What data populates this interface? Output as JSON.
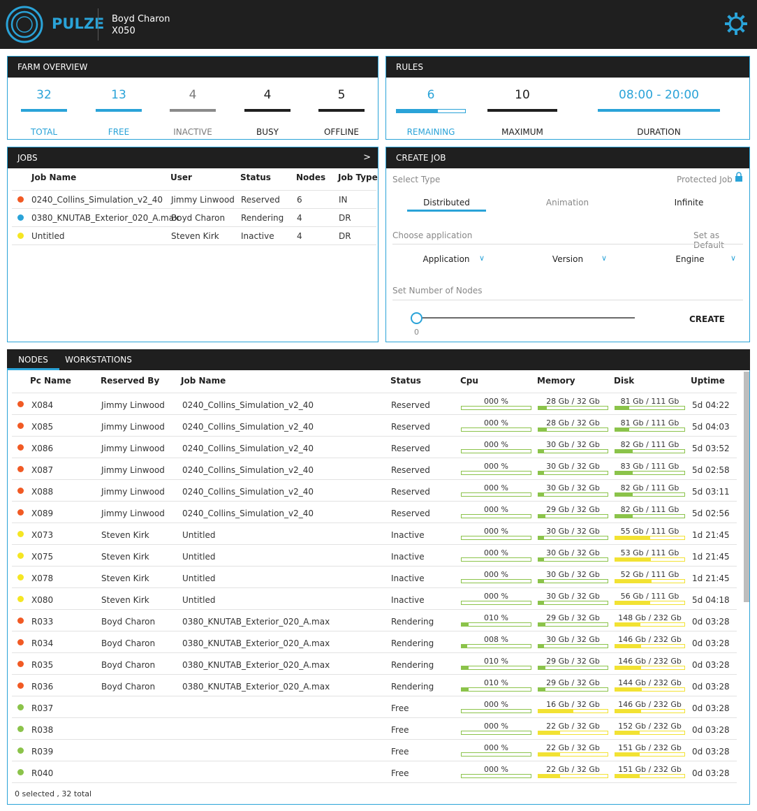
{
  "header": {
    "brand": "PULZE",
    "user_name": "Boyd Charon",
    "user_station": "X050"
  },
  "farm_overview": {
    "title": "FARM OVERVIEW",
    "stats": [
      {
        "value": "32",
        "label": "TOTAL"
      },
      {
        "value": "13",
        "label": "FREE"
      },
      {
        "value": "4",
        "label": "INACTIVE"
      },
      {
        "value": "4",
        "label": "BUSY"
      },
      {
        "value": "5",
        "label": "OFFLINE"
      }
    ]
  },
  "rules": {
    "title": "RULES",
    "remaining": {
      "value": "6",
      "label": "REMAINING",
      "fraction": 0.6
    },
    "maximum": {
      "value": "10",
      "label": "MAXIMUM"
    },
    "duration": {
      "value": "08:00 - 20:00",
      "label": "DURATION"
    }
  },
  "jobs": {
    "title": "JOBS",
    "expand": ">",
    "columns": [
      "Job Name",
      "User",
      "Status",
      "Nodes",
      "Job Type"
    ],
    "rows": [
      {
        "dot": "#f15a24",
        "name": "0240_Collins_Simulation_v2_40",
        "user": "Jimmy Linwood",
        "status": "Reserved",
        "nodes": "6",
        "type": "IN"
      },
      {
        "dot": "#2aa3d8",
        "name": "0380_KNUTAB_Exterior_020_A.max",
        "user": "Boyd Charon",
        "status": "Rendering",
        "nodes": "4",
        "type": "DR"
      },
      {
        "dot": "#f5e623",
        "name": "Untitled",
        "user": "Steven Kirk",
        "status": "Inactive",
        "nodes": "4",
        "type": "DR"
      }
    ]
  },
  "create_job": {
    "title": "CREATE JOB",
    "select_type": "Select Type",
    "protected_job": "Protected Job",
    "types": [
      "Distributed",
      "Animation",
      "Infinite"
    ],
    "choose_application": "Choose application",
    "set_as_default": "Set as Default",
    "selects": [
      "Application",
      "Version",
      "Engine"
    ],
    "set_nodes": "Set Number of Nodes",
    "slider_value": "0",
    "create_label": "CREATE"
  },
  "nodes": {
    "tabs": [
      "NODES",
      "WORKSTATIONS"
    ],
    "columns": [
      "Pc Name",
      "Reserved By",
      "Job Name",
      "Status",
      "Cpu",
      "Memory",
      "Disk",
      "Uptime"
    ],
    "rows": [
      {
        "dot": "#f15a24",
        "pc": "X084",
        "by": "Jimmy Linwood",
        "job": "0240_Collins_Simulation_v2_40",
        "status": "Reserved",
        "cpu": "000 %",
        "cpu_f": 0.0,
        "mem": "28 Gb / 32 Gb",
        "mem_f": 0.12,
        "mem_c": "g",
        "disk": "81 Gb / 111 Gb",
        "disk_f": 0.2,
        "disk_c": "g",
        "uptime": "5d 04:22"
      },
      {
        "dot": "#f15a24",
        "pc": "X085",
        "by": "Jimmy Linwood",
        "job": "0240_Collins_Simulation_v2_40",
        "status": "Reserved",
        "cpu": "000 %",
        "cpu_f": 0.0,
        "mem": "28 Gb / 32 Gb",
        "mem_f": 0.12,
        "mem_c": "g",
        "disk": "81 Gb / 111 Gb",
        "disk_f": 0.2,
        "disk_c": "g",
        "uptime": "5d 04:03"
      },
      {
        "dot": "#f15a24",
        "pc": "X086",
        "by": "Jimmy Linwood",
        "job": "0240_Collins_Simulation_v2_40",
        "status": "Reserved",
        "cpu": "000 %",
        "cpu_f": 0.0,
        "mem": "30 Gb / 32 Gb",
        "mem_f": 0.08,
        "mem_c": "g",
        "disk": "82 Gb / 111 Gb",
        "disk_f": 0.25,
        "disk_c": "g",
        "uptime": "5d 03:52"
      },
      {
        "dot": "#f15a24",
        "pc": "X087",
        "by": "Jimmy Linwood",
        "job": "0240_Collins_Simulation_v2_40",
        "status": "Reserved",
        "cpu": "000 %",
        "cpu_f": 0.0,
        "mem": "30 Gb / 32 Gb",
        "mem_f": 0.08,
        "mem_c": "g",
        "disk": "83 Gb / 111 Gb",
        "disk_f": 0.25,
        "disk_c": "g",
        "uptime": "5d 02:58"
      },
      {
        "dot": "#f15a24",
        "pc": "X088",
        "by": "Jimmy Linwood",
        "job": "0240_Collins_Simulation_v2_40",
        "status": "Reserved",
        "cpu": "000 %",
        "cpu_f": 0.0,
        "mem": "30 Gb / 32 Gb",
        "mem_f": 0.08,
        "mem_c": "g",
        "disk": "82 Gb / 111 Gb",
        "disk_f": 0.25,
        "disk_c": "g",
        "uptime": "5d 03:11"
      },
      {
        "dot": "#f15a24",
        "pc": "X089",
        "by": "Jimmy Linwood",
        "job": "0240_Collins_Simulation_v2_40",
        "status": "Reserved",
        "cpu": "000 %",
        "cpu_f": 0.0,
        "mem": "29 Gb / 32 Gb",
        "mem_f": 0.1,
        "mem_c": "g",
        "disk": "82 Gb / 111 Gb",
        "disk_f": 0.25,
        "disk_c": "g",
        "uptime": "5d 02:56"
      },
      {
        "dot": "#f5e623",
        "pc": "X073",
        "by": "Steven Kirk",
        "job": "Untitled",
        "status": "Inactive",
        "cpu": "000 %",
        "cpu_f": 0.0,
        "mem": "30 Gb / 32 Gb",
        "mem_f": 0.08,
        "mem_c": "g",
        "disk": "55 Gb / 111 Gb",
        "disk_f": 0.5,
        "disk_c": "y",
        "uptime": "1d 21:45"
      },
      {
        "dot": "#f5e623",
        "pc": "X075",
        "by": "Steven Kirk",
        "job": "Untitled",
        "status": "Inactive",
        "cpu": "000 %",
        "cpu_f": 0.0,
        "mem": "30 Gb / 32 Gb",
        "mem_f": 0.08,
        "mem_c": "g",
        "disk": "53 Gb / 111 Gb",
        "disk_f": 0.52,
        "disk_c": "y",
        "uptime": "1d 21:45"
      },
      {
        "dot": "#f5e623",
        "pc": "X078",
        "by": "Steven Kirk",
        "job": "Untitled",
        "status": "Inactive",
        "cpu": "000 %",
        "cpu_f": 0.0,
        "mem": "30 Gb / 32 Gb",
        "mem_f": 0.08,
        "mem_c": "g",
        "disk": "52 Gb / 111 Gb",
        "disk_f": 0.53,
        "disk_c": "y",
        "uptime": "1d 21:45"
      },
      {
        "dot": "#f5e623",
        "pc": "X080",
        "by": "Steven Kirk",
        "job": "Untitled",
        "status": "Inactive",
        "cpu": "000 %",
        "cpu_f": 0.0,
        "mem": "30 Gb / 32 Gb",
        "mem_f": 0.08,
        "mem_c": "g",
        "disk": "56 Gb / 111 Gb",
        "disk_f": 0.5,
        "disk_c": "y",
        "uptime": "5d 04:18"
      },
      {
        "dot": "#f15a24",
        "pc": "R033",
        "by": "Boyd Charon",
        "job": "0380_KNUTAB_Exterior_020_A.max",
        "status": "Rendering",
        "cpu": "010 %",
        "cpu_f": 0.1,
        "mem": "29 Gb / 32 Gb",
        "mem_f": 0.1,
        "mem_c": "g",
        "disk": "148 Gb / 232 Gb",
        "disk_f": 0.36,
        "disk_c": "y",
        "uptime": "0d 03:28"
      },
      {
        "dot": "#f15a24",
        "pc": "R034",
        "by": "Boyd Charon",
        "job": "0380_KNUTAB_Exterior_020_A.max",
        "status": "Rendering",
        "cpu": "008 %",
        "cpu_f": 0.08,
        "mem": "30 Gb / 32 Gb",
        "mem_f": 0.08,
        "mem_c": "g",
        "disk": "146 Gb / 232 Gb",
        "disk_f": 0.37,
        "disk_c": "y",
        "uptime": "0d 03:28"
      },
      {
        "dot": "#f15a24",
        "pc": "R035",
        "by": "Boyd Charon",
        "job": "0380_KNUTAB_Exterior_020_A.max",
        "status": "Rendering",
        "cpu": "010 %",
        "cpu_f": 0.1,
        "mem": "29 Gb / 32 Gb",
        "mem_f": 0.1,
        "mem_c": "g",
        "disk": "146 Gb / 232 Gb",
        "disk_f": 0.37,
        "disk_c": "y",
        "uptime": "0d 03:28"
      },
      {
        "dot": "#f15a24",
        "pc": "R036",
        "by": "Boyd Charon",
        "job": "0380_KNUTAB_Exterior_020_A.max",
        "status": "Rendering",
        "cpu": "010 %",
        "cpu_f": 0.1,
        "mem": "29 Gb / 32 Gb",
        "mem_f": 0.1,
        "mem_c": "g",
        "disk": "144 Gb / 232 Gb",
        "disk_f": 0.38,
        "disk_c": "y",
        "uptime": "0d 03:28"
      },
      {
        "dot": "#8bc34a",
        "pc": "R037",
        "by": "",
        "job": "",
        "status": "Free",
        "cpu": "000 %",
        "cpu_f": 0.0,
        "mem": "16 Gb / 32 Gb",
        "mem_f": 0.5,
        "mem_c": "y",
        "disk": "146 Gb / 232 Gb",
        "disk_f": 0.37,
        "disk_c": "y",
        "uptime": "0d 03:28"
      },
      {
        "dot": "#8bc34a",
        "pc": "R038",
        "by": "",
        "job": "",
        "status": "Free",
        "cpu": "000 %",
        "cpu_f": 0.0,
        "mem": "22 Gb / 32 Gb",
        "mem_f": 0.31,
        "mem_c": "y",
        "disk": "152 Gb / 232 Gb",
        "disk_f": 0.35,
        "disk_c": "y",
        "uptime": "0d 03:28"
      },
      {
        "dot": "#8bc34a",
        "pc": "R039",
        "by": "",
        "job": "",
        "status": "Free",
        "cpu": "000 %",
        "cpu_f": 0.0,
        "mem": "22 Gb / 32 Gb",
        "mem_f": 0.31,
        "mem_c": "y",
        "disk": "151 Gb / 232 Gb",
        "disk_f": 0.35,
        "disk_c": "y",
        "uptime": "0d 03:28"
      },
      {
        "dot": "#8bc34a",
        "pc": "R040",
        "by": "",
        "job": "",
        "status": "Free",
        "cpu": "000 %",
        "cpu_f": 0.0,
        "mem": "22 Gb / 32 Gb",
        "mem_f": 0.31,
        "mem_c": "y",
        "disk": "151 Gb / 232 Gb",
        "disk_f": 0.35,
        "disk_c": "y",
        "uptime": "0d 03:28"
      }
    ],
    "footer": "0 selected , 32 total"
  },
  "colors": {
    "accent": "#2aa3d8",
    "header_bg": "#1f1f1f",
    "reserved": "#f15a24",
    "inactive": "#f5e623",
    "free": "#8bc34a",
    "rendering_job": "#2aa3d8"
  },
  "icons": [
    "pulze-logo-icon",
    "settings-gear-icon",
    "lock-icon",
    "chevron-down-icon",
    "status-dot-icon"
  ]
}
